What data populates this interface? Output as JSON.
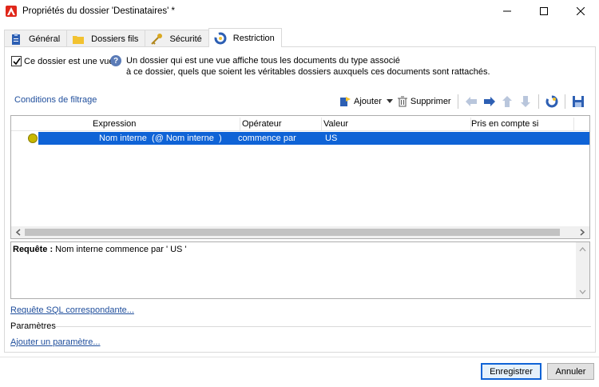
{
  "window": {
    "title": "Propriétés du dossier 'Destinataires' *"
  },
  "tabs": [
    {
      "label": "Général",
      "icon": "clipboard-icon"
    },
    {
      "label": "Dossiers fils",
      "icon": "folder-icon"
    },
    {
      "label": "Sécurité",
      "icon": "key-icon"
    },
    {
      "label": "Restriction",
      "icon": "restriction-icon",
      "active": true
    }
  ],
  "restriction": {
    "checkbox_label": "Ce dossier est une vue",
    "checkbox_checked": true,
    "help_line1": "Un dossier qui est une vue affiche tous les documents du type associé",
    "help_line2": "à ce dossier, quels que soient les véritables dossiers auxquels ces documents sont rattachés."
  },
  "filter": {
    "title": "Conditions de filtrage",
    "add_label": "Ajouter",
    "delete_label": "Supprimer"
  },
  "grid": {
    "columns": [
      "Expression",
      "Opérateur",
      "Valeur",
      "Pris en compte si"
    ],
    "rows": [
      {
        "expression": "Nom interne  (@ Nom interne  )",
        "operator": "commence par",
        "value": "US",
        "condition": ""
      }
    ]
  },
  "query": {
    "label": "Requête :",
    "text": " Nom interne commence par ' US '"
  },
  "links": {
    "sql": "Requête SQL correspondante...",
    "add_param": "Ajouter un paramètre..."
  },
  "params_label": "Paramètres",
  "buttons": {
    "save": "Enregistrer",
    "cancel": "Annuler"
  },
  "colors": {
    "selection": "#0f63d6",
    "link": "#1f4e9c",
    "accent_red": "#e0271a"
  }
}
